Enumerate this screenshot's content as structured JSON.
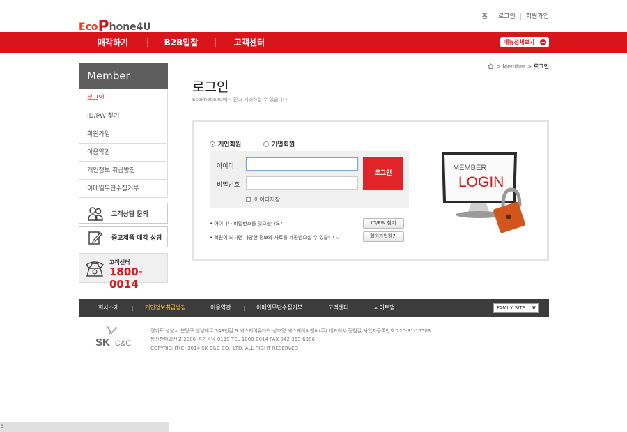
{
  "brand": {
    "logo_eco": "Eco",
    "logo_p": "P",
    "logo_rest": "hone4U"
  },
  "util_nav": {
    "home": "홈",
    "login": "로그인",
    "join": "회원가입"
  },
  "gnb": {
    "items": [
      "매각하기",
      "B2B입찰",
      "고객센터"
    ],
    "menu_all": "메뉴전체보기",
    "menu_all_icon": "+"
  },
  "sidebar": {
    "title": "Member",
    "items": [
      {
        "label": "로그인",
        "active": true
      },
      {
        "label": "ID/PW 찾기"
      },
      {
        "label": "회원가입"
      },
      {
        "label": "이용약관"
      },
      {
        "label": "개인정보 취급방침"
      },
      {
        "label": "이메일무단수집거부"
      }
    ],
    "consult1": "고객상담 문의",
    "consult2": "중고제품 매각 상담",
    "cs_label": "고객센터",
    "cs_phone": "1800-0014"
  },
  "breadcrumb": {
    "home_icon": "home-icon",
    "level1": "Member",
    "current": "로그인"
  },
  "page": {
    "title": "로그인",
    "desc": "EcoPhone4U에서 믿고 거래하실 수 있습니다."
  },
  "login": {
    "radio_personal": "개인회원",
    "radio_company": "기업회원",
    "id_label": "아이디",
    "pw_label": "비밀번호",
    "id_value": "",
    "pw_value": "",
    "login_button": "로그인",
    "save_id": "아이디저장",
    "help1": "• 아이디나 비밀번호를 잊으셨나요?",
    "help2": "• 회원이 되시면 다양한 정보와 자료를 제공받으실 수 있습니다.",
    "find_button": "ID/PW 찾기",
    "join_button": "회원가입하기",
    "illustration_text1": "MEMBER",
    "illustration_text2": "LOGIN"
  },
  "footer": {
    "links": [
      {
        "label": "회사소개"
      },
      {
        "label": "개인정보취급방침",
        "highlight": true
      },
      {
        "label": "이용약관"
      },
      {
        "label": "이메일무단수집거부"
      },
      {
        "label": "고객센터"
      },
      {
        "label": "사이트맵"
      }
    ],
    "family_site": "FAMILY SITE",
    "sk_logo": "SK",
    "sk_logo2": "C&C",
    "address1": "경기도 성남시 분당구 성남대로 343번길 9 에스케이유타워  상호명 에스케이씨앤씨(주)  대표이사 정철길  사업자등록번호 220-81-16503",
    "address2": "통신판매업신고 2006-경기성남-0119  TEL 1800-0014  FAX 042-363-6386",
    "copyright": "COPYRIGHT(C) 2014 SK C&C CO., LTD. ALL RIGHT RESERVED"
  },
  "scrollbar_num": "0",
  "colors": {
    "brand_red": "#d8151b",
    "footer_dark": "#3c3c3c",
    "highlight": "#f0c33c"
  }
}
